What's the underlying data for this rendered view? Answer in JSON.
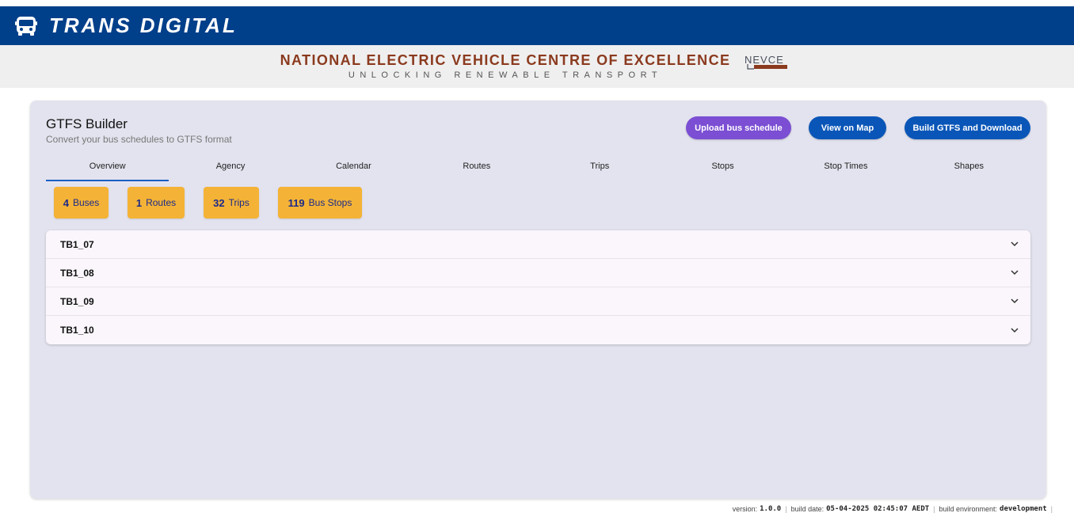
{
  "app": {
    "title": "TRANS DIGITAL"
  },
  "banner": {
    "title": "NATIONAL ELECTRIC VEHICLE CENTRE OF EXCELLENCE",
    "subtitle": "UNLOCKING RENEWABLE TRANSPORT",
    "logo_text": "NEVCE"
  },
  "builder": {
    "title": "GTFS Builder",
    "subtitle": "Convert your bus schedules to GTFS format"
  },
  "actions": {
    "upload_label": "Upload bus schedule",
    "map_label": "View on Map",
    "build_label": "Build GTFS and Download"
  },
  "tabs": [
    {
      "label": "Overview",
      "active": true
    },
    {
      "label": "Agency"
    },
    {
      "label": "Calendar"
    },
    {
      "label": "Routes"
    },
    {
      "label": "Trips"
    },
    {
      "label": "Stops"
    },
    {
      "label": "Stop Times"
    },
    {
      "label": "Shapes"
    }
  ],
  "stats": [
    {
      "value": "4",
      "label": "Buses"
    },
    {
      "value": "1",
      "label": "Routes"
    },
    {
      "value": "32",
      "label": "Trips"
    },
    {
      "value": "119",
      "label": "Bus Stops"
    }
  ],
  "buses": [
    {
      "label": "TB1_07"
    },
    {
      "label": "TB1_08"
    },
    {
      "label": "TB1_09"
    },
    {
      "label": "TB1_10"
    }
  ],
  "footer": {
    "version_label": "version:",
    "version_value": "1.0.0",
    "build_date_label": "build date:",
    "build_date_value": "05-04-2025 02:45:07 AEDT",
    "build_env_label": "build environment:",
    "build_env_value": "development"
  },
  "colors": {
    "appbar": "#003f8a",
    "banner_title": "#8b3a1e",
    "upload_button": "#7b4ed3",
    "primary_button": "#0a56b8",
    "stat_chip": "#f4b336",
    "stat_text": "#1c2a8a",
    "tab_indicator": "#1a5fc4"
  }
}
